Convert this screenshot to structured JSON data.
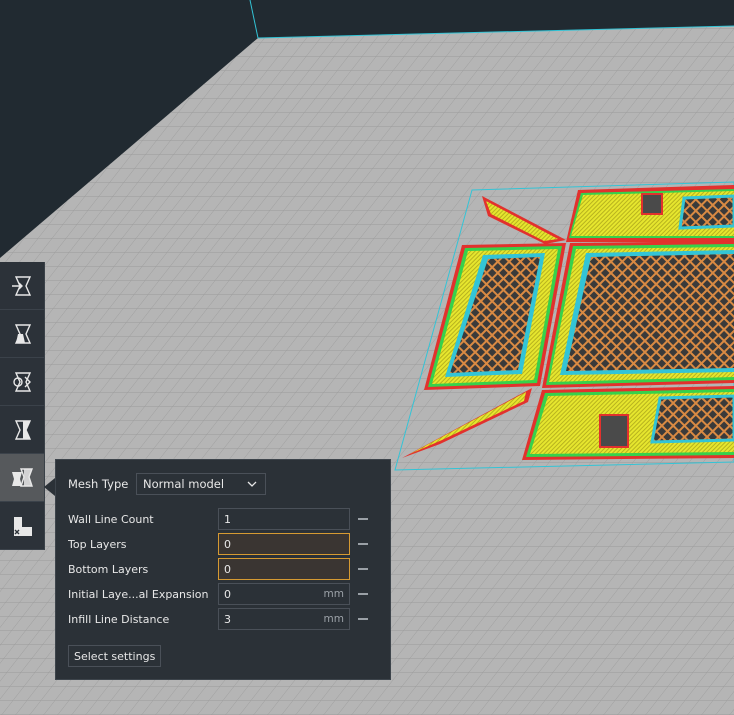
{
  "toolbar": {
    "tools": [
      {
        "id": "tool-1",
        "icon": "print-as-support-icon"
      },
      {
        "id": "tool-2",
        "icon": "overlap-settings-icon"
      },
      {
        "id": "tool-3",
        "icon": "cutting-mesh-icon"
      },
      {
        "id": "tool-4",
        "icon": "support-blocker-icon"
      },
      {
        "id": "tool-5",
        "icon": "per-model-settings-icon",
        "active": true
      },
      {
        "id": "tool-6",
        "icon": "support-eraser-icon"
      }
    ]
  },
  "panel": {
    "mesh_type_label": "Mesh Type",
    "mesh_type_value": "Normal model",
    "settings": [
      {
        "label": "Wall Line Count",
        "value": "1",
        "unit": "",
        "warn": false
      },
      {
        "label": "Top Layers",
        "value": "0",
        "unit": "",
        "warn": true
      },
      {
        "label": "Bottom Layers",
        "value": "0",
        "unit": "",
        "warn": true
      },
      {
        "label": "Initial Laye...al Expansion",
        "value": "0",
        "unit": "mm",
        "warn": false
      },
      {
        "label": "Infill Line Distance",
        "value": "3",
        "unit": "mm",
        "warn": false
      }
    ],
    "select_settings_label": "Select settings"
  },
  "colors": {
    "background": "#212a31",
    "build_plate": "#b5b5b5",
    "grid": "#9c9c9c",
    "outline": "#33c4d6",
    "wall_outer": "#e2312d",
    "wall_inner": "#37d14b",
    "skin": "#e6e62e",
    "infill": "#d98a43",
    "warning": "#d69a32"
  }
}
